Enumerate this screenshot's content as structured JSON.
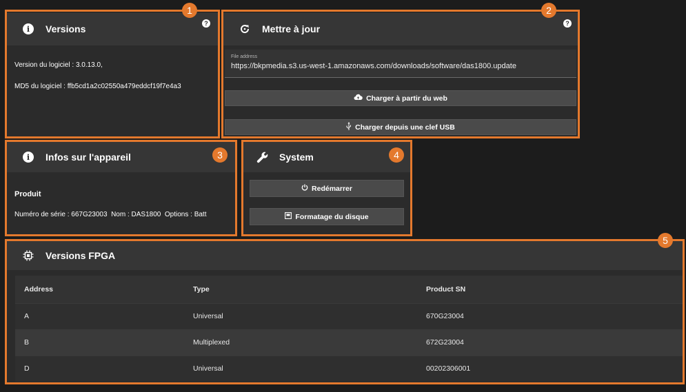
{
  "versions": {
    "title": "Versions",
    "software_version": "Version du logiciel : 3.0.13.0,",
    "md5": "MD5 du logiciel : ffb5cd1a2c02550a479eddcf19f7e4a3"
  },
  "update": {
    "title": "Mettre à jour",
    "file_address_label": "File address",
    "file_address_value": "https://bkpmedia.s3.us-west-1.amazonaws.com/downloads/software/das1800.update",
    "web_button": "Charger à partir du web",
    "usb_button": "Charger depuis une clef USB"
  },
  "device": {
    "title": "Infos sur l'appareil",
    "product": "Produit",
    "details": "Numéro de série : 667G23003  Nom : DAS1800  Options : Batt"
  },
  "system": {
    "title": "System",
    "reboot_button": "Redémarrer",
    "format_button": "Formatage du disque"
  },
  "fpga": {
    "title": "Versions FPGA",
    "columns": [
      "Address",
      "Type",
      "Product SN"
    ],
    "rows": [
      [
        "A",
        "Universal",
        "670G23004"
      ],
      [
        "B",
        "Multiplexed",
        "672G23004"
      ],
      [
        "D",
        "Universal",
        "00202306001"
      ]
    ]
  },
  "badges": [
    "1",
    "2",
    "3",
    "4",
    "5"
  ],
  "colors": {
    "accent": "#e4792d",
    "background": "#1c1c1c",
    "card": "#2b2b2b",
    "card_header": "#363636"
  },
  "icons": {
    "versions": "info-icon",
    "update": "refresh-icon",
    "device": "info-icon",
    "system": "wrench-icon",
    "fpga": "chip-icon",
    "help": "help-icon",
    "web": "cloud-upload-icon",
    "usb": "usb-icon",
    "reboot": "power-icon",
    "format": "disk-icon"
  }
}
